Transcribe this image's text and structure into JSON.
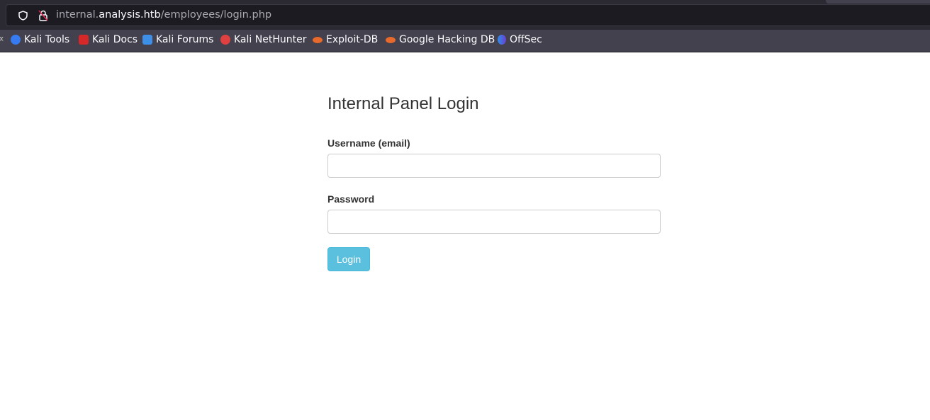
{
  "browser": {
    "url_prefix": "internal.",
    "url_domain": "analysis.htb",
    "url_path": "/employees/login.php",
    "bookmarks": [
      {
        "label": "Kali Tools",
        "icon": "kali-tools-icon",
        "color": "#367bf0"
      },
      {
        "label": "Kali Docs",
        "icon": "kali-docs-icon",
        "color": "#d62828"
      },
      {
        "label": "Kali Forums",
        "icon": "kali-forums-icon",
        "color": "#3d8fe8"
      },
      {
        "label": "Kali NetHunter",
        "icon": "kali-nethunter-icon",
        "color": "#e04040"
      },
      {
        "label": "Exploit-DB",
        "icon": "exploit-db-icon",
        "color": "#e8692c"
      },
      {
        "label": "Google Hacking DB",
        "icon": "ghdb-icon",
        "color": "#e8692c"
      },
      {
        "label": "OffSec",
        "icon": "offsec-icon",
        "color": "#4a5cd8"
      }
    ]
  },
  "page": {
    "title": "Internal Panel Login",
    "username_label": "Username (email)",
    "username_value": "",
    "password_label": "Password",
    "password_value": "",
    "login_button": "Login",
    "button_color": "#5bc0de"
  }
}
